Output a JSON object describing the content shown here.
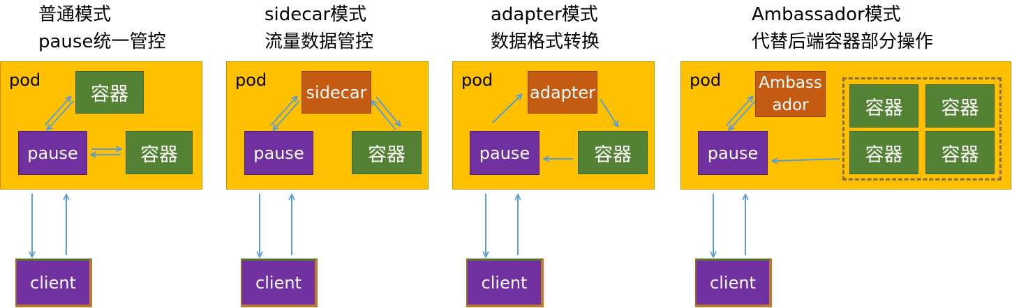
{
  "panels": [
    {
      "title_line1": "普通模式",
      "title_line2": "pause统一管控",
      "pod_label": "pod",
      "container_top": "容器",
      "pause": "pause",
      "container_right": "容器",
      "client": "client"
    },
    {
      "title_line1": "sidecar模式",
      "title_line2": "流量数据管控",
      "pod_label": "pod",
      "sidecar": "sidecar",
      "pause": "pause",
      "container": "容器",
      "client": "client"
    },
    {
      "title_line1": "adapter模式",
      "title_line2": "数据格式转换",
      "pod_label": "pod",
      "adapter": "adapter",
      "pause": "pause",
      "container": "容器",
      "client": "client"
    },
    {
      "title_line1": "Ambassador模式",
      "title_line2": "代替后端容器部分操作",
      "pod_label": "pod",
      "ambassador_line1": "Ambass",
      "ambassador_line2": "ador",
      "pause": "pause",
      "containers": [
        "容器",
        "容器",
        "容器",
        "容器"
      ],
      "client": "client"
    }
  ],
  "colors": {
    "pod": "#ffc000",
    "container": "#548235",
    "pause": "#7030a0",
    "sidecar": "#c55a11",
    "arrow": "#5b9bd5"
  }
}
